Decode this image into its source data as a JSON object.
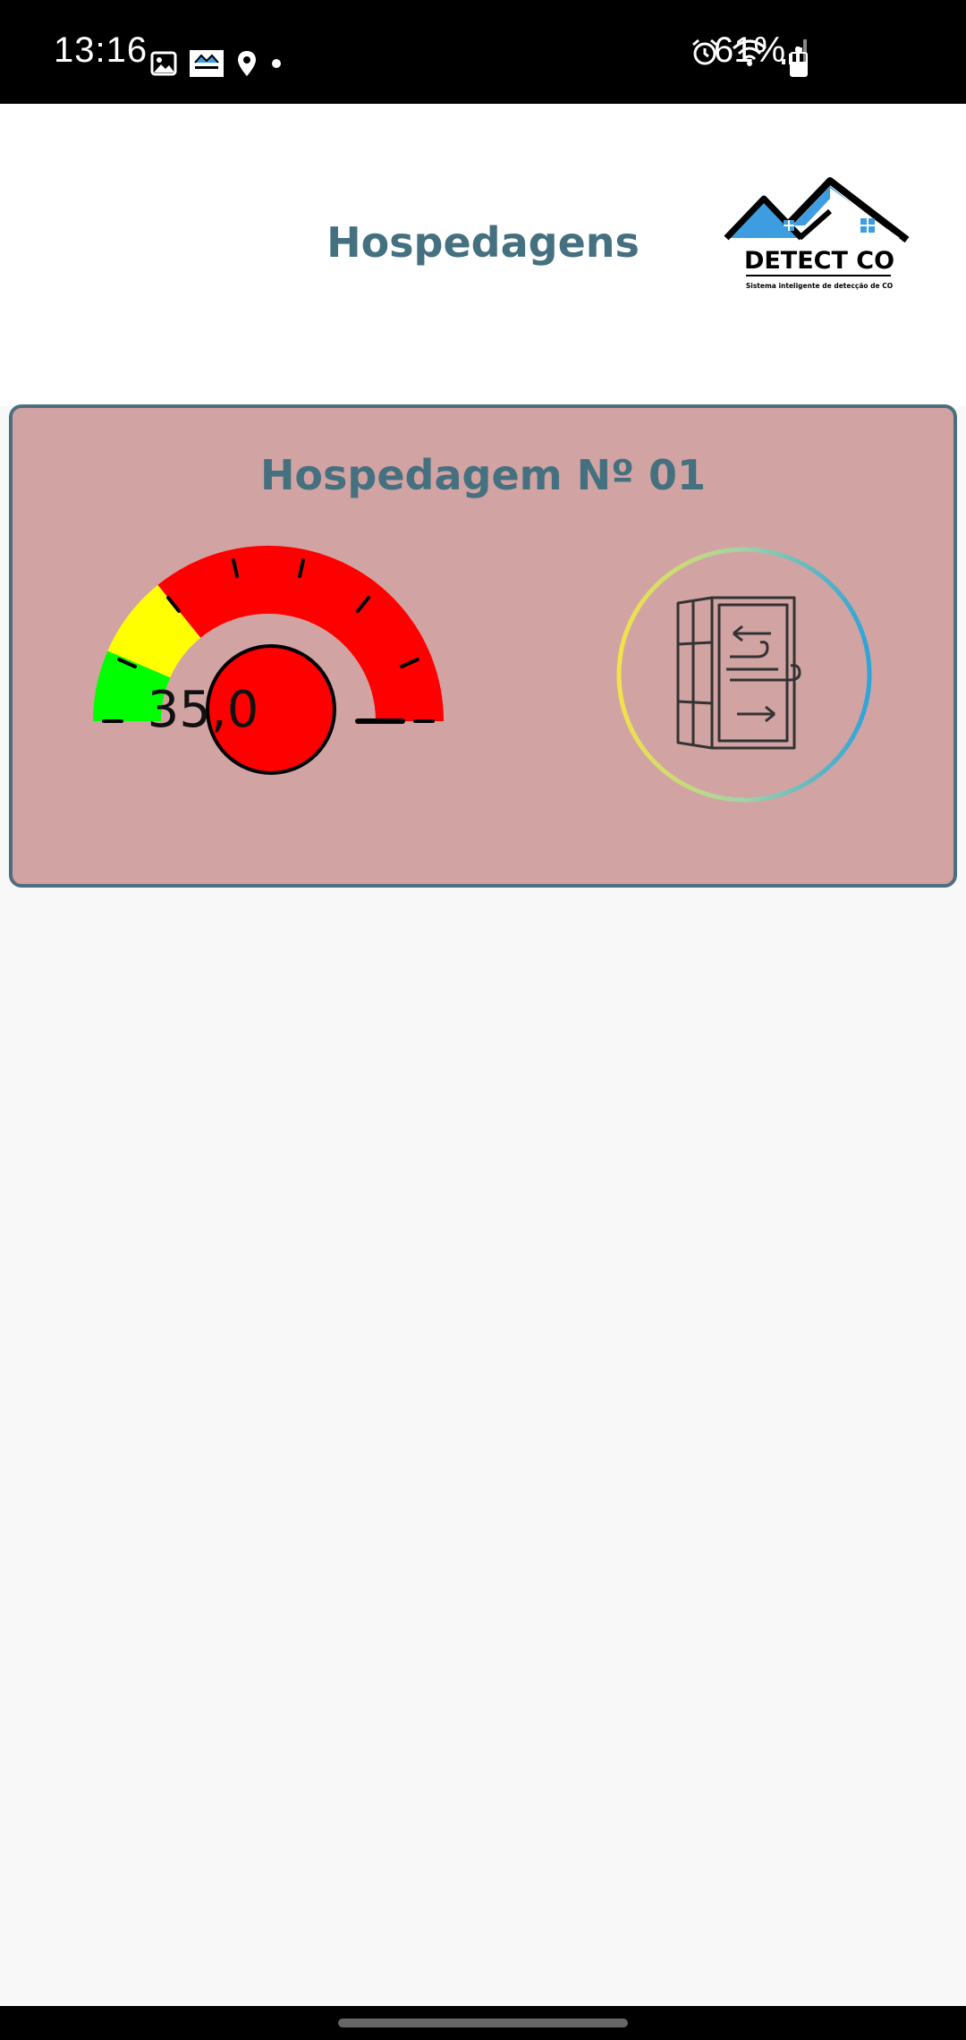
{
  "status_bar": {
    "time": "13:16",
    "battery_percent": "61%",
    "battery_level": 0.61,
    "left_icons": [
      "image-icon",
      "app-logo-notification-icon",
      "location-icon",
      "dot-icon"
    ],
    "right_icons": [
      "alarm-icon",
      "wifi-icon",
      "signal-icon",
      "battery-icon"
    ]
  },
  "header": {
    "title": "Hospedagens",
    "logo": {
      "name": "DETECT CO",
      "tagline": "Sistema inteligente de detecção de CO"
    }
  },
  "cards": [
    {
      "title": "Hospedagem Nº 01",
      "co_reading": "35,0",
      "gauge_zones": [
        "#00ff00",
        "#ffff00",
        "#ff0000"
      ],
      "status_color": "#ff0000",
      "ventilation_icon": "window-ventilation-icon"
    }
  ],
  "colors": {
    "accent": "#44707f",
    "card_background": "#d2a3a3",
    "card_border": "#4c6f80",
    "logo_blue": "#3d9de0"
  }
}
